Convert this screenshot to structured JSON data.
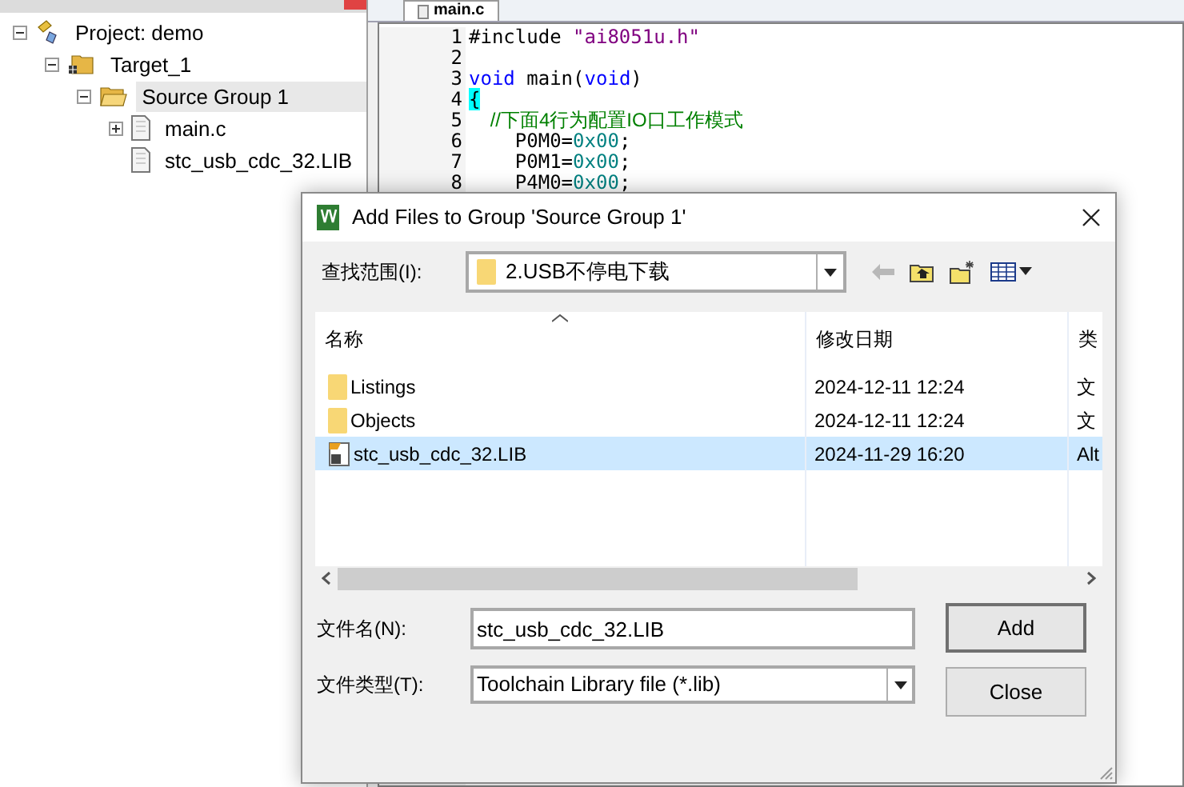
{
  "project_panel": {
    "tree": [
      {
        "label": "Project: demo",
        "kind": "project",
        "expanded": true,
        "selected": false,
        "children": [
          {
            "label": "Target_1",
            "kind": "target",
            "expanded": true,
            "selected": false,
            "children": [
              {
                "label": "Source Group 1",
                "kind": "group",
                "expanded": true,
                "selected": true,
                "children": [
                  {
                    "label": "main.c",
                    "kind": "file",
                    "expanded": false,
                    "selected": false
                  },
                  {
                    "label": "stc_usb_cdc_32.LIB",
                    "kind": "file",
                    "selected": false
                  }
                ]
              }
            ]
          }
        ]
      }
    ]
  },
  "editor": {
    "tabs": [
      {
        "label": "main.c",
        "selected": true
      }
    ],
    "lines": [
      {
        "number": "1",
        "segments": [
          {
            "text": "#include ",
            "kind": "plain"
          },
          {
            "text": "\"ai8051u.h\"",
            "kind": "string"
          }
        ]
      },
      {
        "number": "2"
      },
      {
        "number": "3",
        "segments": [
          {
            "text": "void",
            "kind": "keyword"
          },
          {
            "text": " main(",
            "kind": "plain"
          },
          {
            "text": "void",
            "kind": "keyword"
          },
          {
            "text": ")",
            "kind": "plain"
          }
        ]
      },
      {
        "number": "4",
        "segments": [
          {
            "text": "{",
            "kind": "brace_match"
          }
        ]
      },
      {
        "number": "5",
        "segments": [
          {
            "text": "    //下面4行为配置IO口工作模式",
            "kind": "comment"
          }
        ]
      },
      {
        "number": "6",
        "segments": [
          {
            "text": "    P0M0=",
            "kind": "plain"
          },
          {
            "text": "0x00",
            "kind": "number"
          },
          {
            "text": ";",
            "kind": "plain"
          }
        ]
      },
      {
        "number": "7",
        "segments": [
          {
            "text": "    P0M1=",
            "kind": "plain"
          },
          {
            "text": "0x00",
            "kind": "number"
          },
          {
            "text": ";",
            "kind": "plain"
          }
        ]
      },
      {
        "number": "8",
        "segments": [
          {
            "text": "    P4M0=",
            "kind": "plain"
          },
          {
            "text": "0x00",
            "kind": "number"
          },
          {
            "text": ";",
            "kind": "plain"
          }
        ]
      }
    ]
  },
  "dialog": {
    "title": "Add Files to Group 'Source Group 1'",
    "look_in": {
      "label": "查找范围(I):",
      "value": "2.USB不停电下载"
    },
    "columns": [
      "名称",
      "修改日期",
      "类"
    ],
    "rows": [
      {
        "name": "Listings",
        "date": "2024-12-11 12:24",
        "type": "文",
        "kind": "folder",
        "selected": false
      },
      {
        "name": "Objects",
        "date": "2024-12-11 12:24",
        "type": "文",
        "kind": "folder",
        "selected": false
      },
      {
        "name": "stc_usb_cdc_32.LIB",
        "date": "2024-11-29 16:20",
        "type": "Alt",
        "kind": "library",
        "selected": true
      }
    ],
    "file_name": {
      "label": "文件名(N):",
      "value": "stc_usb_cdc_32.LIB"
    },
    "file_type": {
      "label": "文件类型(T):",
      "value": "Toolchain Library file (*.lib)"
    },
    "buttons": [
      "Add",
      "Close"
    ]
  }
}
